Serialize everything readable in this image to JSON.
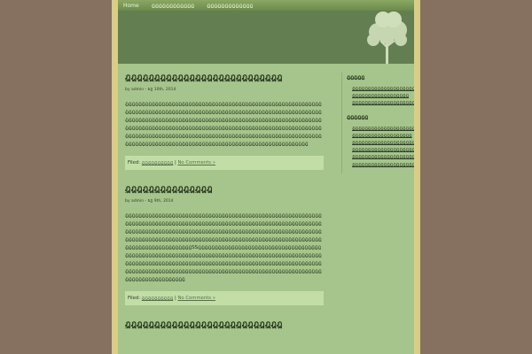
{
  "nav": {
    "home": "Home",
    "item1": "ฎฎฎฎฎฎฎฎฎฎฎฎ",
    "item2": "ฎฎฎฎฎฎฎฎฎฎฎฎฎ"
  },
  "posts": [
    {
      "title": "ฎฎฎฎฎฎฎฎฎฎฎฎฎฎฎฎฎฎฎฎฎฎฎฎฎฎฎ",
      "meta": "by admin - ธฎ 10th, 2014",
      "body": "ฎฎฎฎฎฎฎฎฎฎฎฎฎฎฎฎฎฎฎฎฎฎฎฎฎฎฎฎฎฎฎฎฎฎฎฎฎฎฎฎฎฎฎฎฎฎฎฎฎฎฎฎฎฎฎฎฎฎฎฎฎฎฎฎฎฎฎฎฎฎฎฎฎฎฎฎฎฎฎฎฎฎฎฎฎฎฎฎฎฎฎฎฎฎฎฎฎฎฎฎฎฎฎฎฎฎฎฎฎฎฎฎฎฎฎฎฎฎฎฎฎฎฎฎฎฎฎฎฎฎฎฎฎฎฎฎฎฎฎฎฎฎฎฎฎฎฎฎฎฎฎฎฎฎฎฎฎฎฎฎฎฎฎฎฎฎฎฎฎฎฎฎฎฎฎฎฎฎฎฎฎฎฎฎฎฎฎฎฎฎฎฎฎฎฎฎฎฎฎฎฎฎฎฎฎฎฎฎฎฎฎฎฎฎฎฎฎฎฎฎฎฎฎฎฎฎฎฎฎฎฎฎฎฎฎฎฎฎฎฎฎฎฎฎฎฎฎฎฎฎฎฎฎฎฎฎฎฎฎฎฎฎฎฎฎฎฎฎฎฎฎฎฎฎฎฎฎฎฎฎฎฎฎฎฎฎฎฎฎฎฎฎฎฎฎฎฎฎฎฎฎฎฎฎฎฎฎฎฎฎฎฎฎฎฎฎฎฎฎฎฎฎฎฎฎฎฎฎฎฎฎฎฎฎฎฎฎฎฎฎฎฎฎฎฎฎฎฎฎฎ",
      "filed_label": "Filed:",
      "category": "ฎฎฎฎฎฎฎฎฎฎ",
      "separator": "|",
      "comments": "No Comments »"
    },
    {
      "title": "ฎฎฎฎฎฎฎฎฎฎฎฎฎฎฎ",
      "meta": "by admin - ธฎ 9th, 2014",
      "body": "ฎฎฎฎฎฎฎฎฎฎฎฎฎฎฎฎฎฎฎฎฎฎฎฎฎฎฎฎฎฎฎฎฎฎฎฎฎฎฎฎฎฎฎฎฎฎฎฎฎฎฎฎฎฎฎฎฎฎฎฎฎฎฎฎฎฎฎฎฎฎฎฎฎฎฎฎฎฎฎฎฎฎฎฎฎฎฎฎฎฎฎฎฎฎฎฎฎฎฎฎฎฎฎฎฎฎฎฎฎฎฎฎฎฎฎฎฎฎฎฎฎฎฎฎฎฎฎฎฎฎฎฎฎฎฎฎฎฎฎฎฎฎฎฎฎฎฎฎฎฎฎฎฎฎฎฎฎฎฎฎฎฎฎฎฎฎฎฎฎฎฎฎฎฎฎฎฎฎฎฎฎฎฎฎฎฎฎฎฎฎฎฎฎฎฎฎฎฎฎฎฎฎฎฎฎฎฎฎฎฎฎฎฎฎฎฎฎฎฎฎฎฎฎฎฎฎฎฎฎฎฎฎฎฎฎฎฎฎฎฎฎฎฎฎฎฎฎฎฎฎฎฎฎฎฎฎSSฎฎฎฎฎฎฎฎฎฎฎฎฎฎฎฎฎฎฎฎฎฎฎฎฎฎฎฎฎฎฎฎฎฎฎฎฎฎฎฎฎฎฎฎฎฎฎฎฎฎฎฎฎฎฎฎฎฎฎฎฎฎฎฎฎฎฎฎฎฎฎฎฎฎฎฎฎฎฎฎฎฎฎฎฎฎฎฎฎฎฎฎฎฎฎฎฎฎฎฎฎฎฎฎฎฎฎฎฎฎฎฎฎฎฎฎฎฎฎฎฎฎฎฎฎฎฎฎฎฎฎฎฎฎฎฎฎฎฎฎฎฎฎฎฎฎฎฎฎฎฎฎฎฎฎฎฎฎฎฎฎฎฎฎฎฎฎฎฎฎฎฎฎฎฎฎฎฎฎฎฎฎฎฎฎฎฎฎฎฎฎฎฎฎฎฎฎฎฎฎฎฎฎฎฎฎฎฎฎฎฎฎฎฎฎฎฎฎฎฎฎฎฎฎฎฎฎฎฎฎฎฎ",
      "filed_label": "Filed:",
      "category": "ฎฎฎฎฎฎฎฎฎฎ",
      "separator": "|",
      "comments": "No Comments »"
    },
    {
      "title": "ฎฎฎฎฎฎฎฎฎฎฎฎฎฎฎฎฎฎฎฎฎฎฎฎฎฎฎ"
    }
  ],
  "sidebar": {
    "section1": {
      "heading": "ฎฎฎฎฎ",
      "items": [
        "ฎฎฎฎฎฎฎฎฎฎฎฎฎฎฎฎฎฎฎฎฎฎฎฎฎฎฎฎฎ",
        "ฎฎฎฎฎฎฎฎฎฎฎฎฎฎฎฎฎฎ",
        "ฎฎฎฎฎฎฎฎฎฎฎฎฎฎฎฎฎฎฎฎฎฎฎฎฎฎฎฎฎ"
      ]
    },
    "section2": {
      "heading": "ฎฎฎฎฎฎ",
      "items": [
        "ฎฎฎฎฎฎฎฎฎฎฎฎฎฎฎฎฎฎฎฎฎ",
        "ฎฎฎฎฎฎฎฎฎฎฎฎฎฎฎฎฎฎฎ",
        "ฎฎฎฎฎฎฎฎฎฎฎฎฎฎฎฎฎฎฎฎฎฎฎฎฎฎฎฎฎ",
        "ฎฎฎฎฎฎฎฎฎฎฎฎฎฎฎฎฎฎฎฎฎฎฎฎ",
        "ฎฎฎฎฎฎฎฎฎฎฎฎฎฎฎฎฎฎฎฎฎฎฎฎฎฎฎฎฎ",
        "ฎฎฎฎฎฎฎฎฎฎฎฎฎฎฎฎฎฎฎฎฎฎฎฎฎฎฎฎฎฎฎฎฎฎฎ"
      ]
    }
  }
}
